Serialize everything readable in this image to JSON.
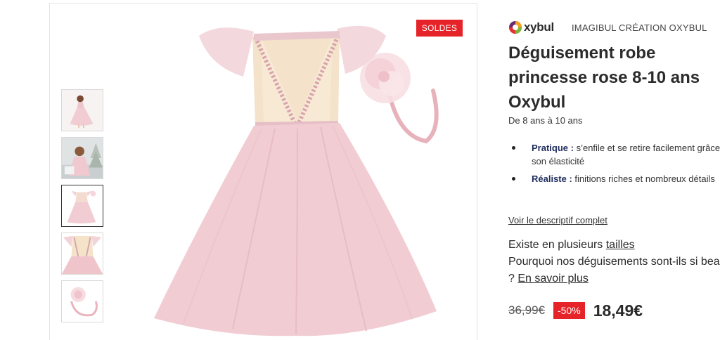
{
  "badge": {
    "soldes": "SOLDES"
  },
  "brand": {
    "logo_text": "xybul",
    "name": "IMAGIBUL CRÉATION OXYBUL"
  },
  "product": {
    "title": "Déguisement robe princesse rose 8-10 ans Oxybul",
    "age": "De 8 ans à 10 ans",
    "features": [
      {
        "label": "Pratique :",
        "text": " s’enfile et se retire facilement grâce à son élasticité"
      },
      {
        "label": "Réaliste :",
        "text": " finitions riches et nombreux détails"
      }
    ],
    "description_link": "Voir le descriptif complet",
    "sizes_text": "Existe en plusieurs ",
    "sizes_link": "tailles",
    "why_text": "Pourquoi nos déguisements sont-ils si beaux ? ",
    "why_link": "En savoir plus"
  },
  "price": {
    "old": "36,99€",
    "discount": "-50%",
    "new": "18,49€"
  },
  "gallery": {
    "active_thumbnail": 3,
    "thumbnail_count": 5
  },
  "colors": {
    "sale_red": "#e62328",
    "dress_pink": "#f1cdd3",
    "text_dark": "#2a2a2a"
  },
  "icons": {
    "logo": "oxybul-logo-icon",
    "thumb_1": "girl-in-dress-photo-icon",
    "thumb_2": "girl-with-tree-photo-icon",
    "thumb_3": "dress-front-photo-icon",
    "thumb_4": "dress-detail-photo-icon",
    "thumb_5": "headband-photo-icon"
  }
}
